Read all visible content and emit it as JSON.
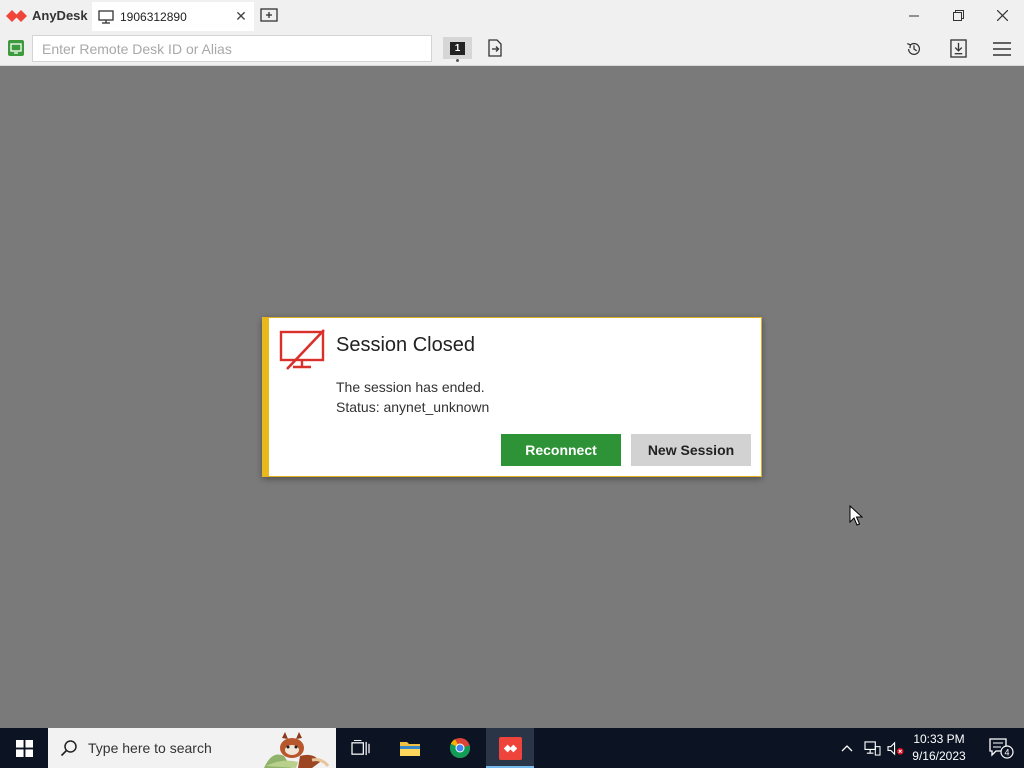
{
  "window": {
    "app_name": "AnyDesk",
    "tab_label": "1906312890"
  },
  "toolbar": {
    "address_placeholder": "Enter Remote Desk ID or Alias",
    "monitor_number": "1"
  },
  "dialog": {
    "title": "Session Closed",
    "message": "The session has ended.",
    "status": "Status: anynet_unknown",
    "reconnect_label": "Reconnect",
    "new_session_label": "New Session"
  },
  "taskbar": {
    "search_placeholder": "Type here to search",
    "time": "10:33 PM",
    "date": "9/16/2023",
    "notification_count": "4"
  },
  "colors": {
    "accent_red": "#ef443b",
    "reconnect_green": "#2e9236",
    "dialog_border": "#e8b81c"
  }
}
